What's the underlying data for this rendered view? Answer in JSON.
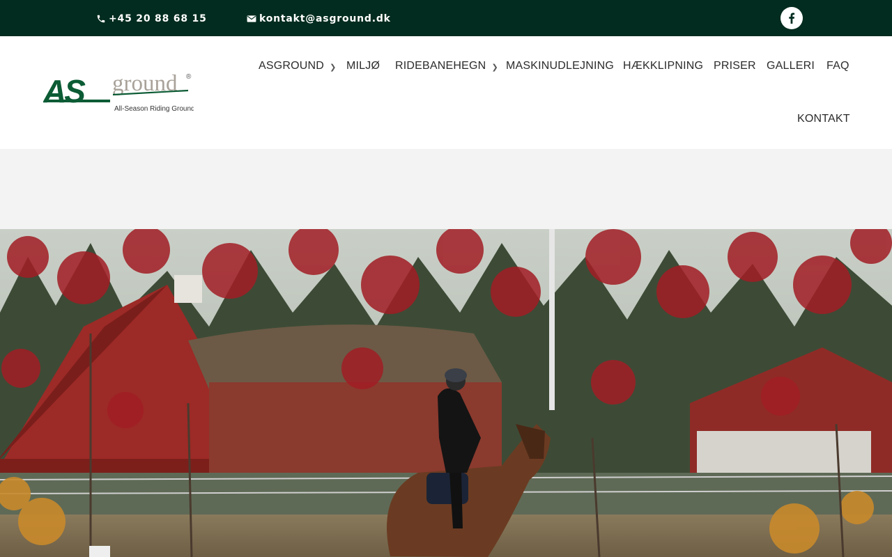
{
  "topbar": {
    "phone": "+45 20 88 68 15",
    "email": "kontakt@asground.dk",
    "social_icon": "facebook-icon"
  },
  "logo": {
    "brand_bold": "AS",
    "brand_light": "ground",
    "registered": "®",
    "tagline": "All-Season Riding Ground"
  },
  "nav": {
    "items": [
      {
        "label": "ASGROUND",
        "has_dropdown": true
      },
      {
        "label": "MILJØ",
        "has_dropdown": false
      },
      {
        "label": "RIDEBANEHEGN",
        "has_dropdown": true
      },
      {
        "label": "MASKINUDLEJNING",
        "has_dropdown": false
      },
      {
        "label": "HÆKKLIPNING",
        "has_dropdown": false
      },
      {
        "label": "PRISER",
        "has_dropdown": false
      },
      {
        "label": "GALLERI",
        "has_dropdown": false
      },
      {
        "label": "FAQ",
        "has_dropdown": false
      },
      {
        "label": "KONTAKT",
        "has_dropdown": false
      }
    ],
    "dropdown_glyph": "3"
  },
  "colors": {
    "topbar_bg": "#022c1f",
    "brand_green": "#0b5b34",
    "brand_gray": "#a9a29a",
    "spacer_bg": "#f3f3f3"
  }
}
